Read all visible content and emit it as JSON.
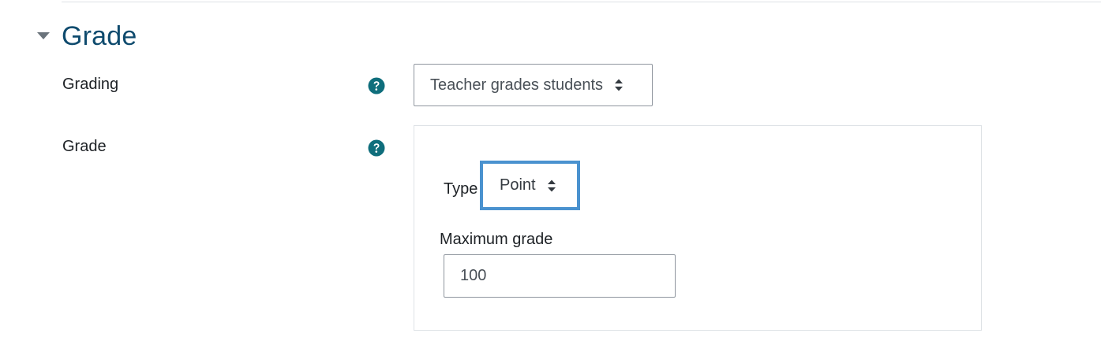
{
  "section": {
    "title": "Grade",
    "collapse_icon": "caret-down-icon"
  },
  "grading": {
    "label": "Grading",
    "help_icon": "question-circle-icon",
    "selected": "Teacher grades students"
  },
  "grade": {
    "label": "Grade",
    "help_icon": "question-circle-icon",
    "type_label": "Type",
    "type_selected": "Point",
    "max_grade_label": "Maximum grade",
    "max_grade_value": "100"
  },
  "colors": {
    "title": "#0f4b6e",
    "help_icon": "#0f6e7c",
    "focus_border": "#4a92cf"
  }
}
